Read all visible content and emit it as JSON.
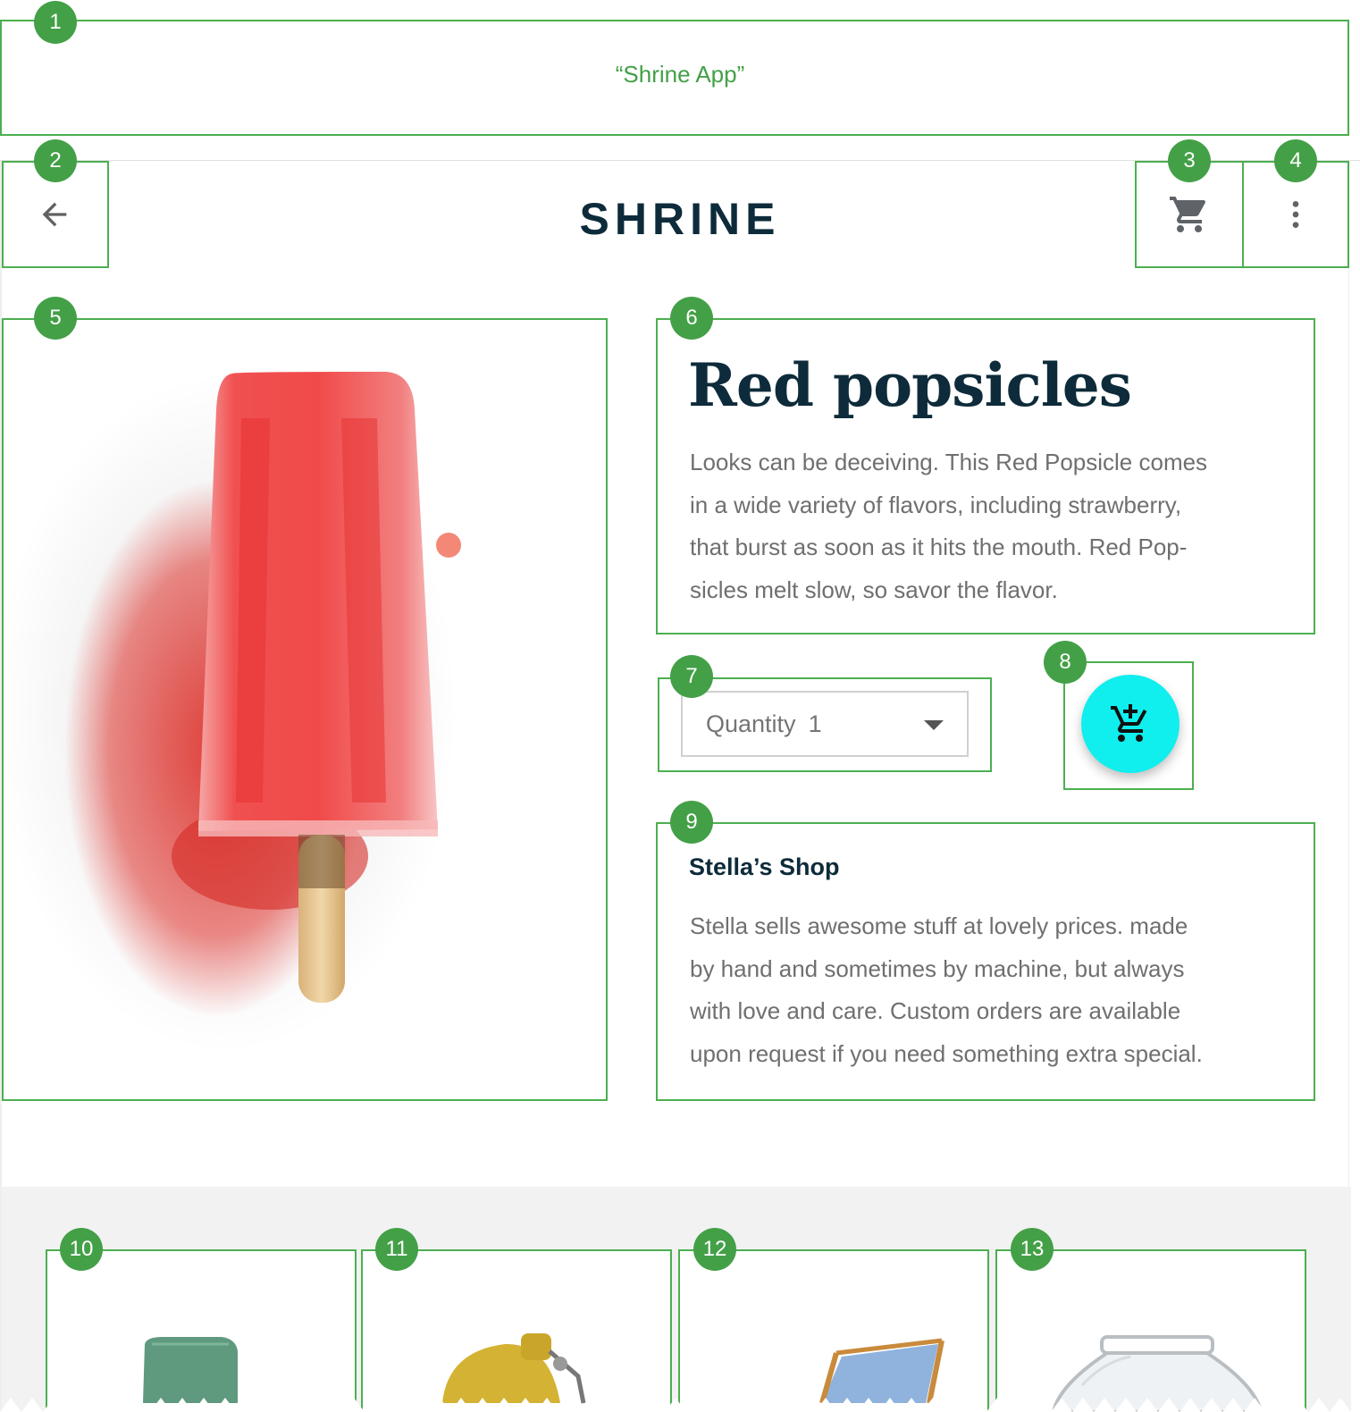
{
  "annotation": {
    "caption": "“Shrine App”",
    "labels": [
      "1",
      "2",
      "3",
      "4",
      "5",
      "6",
      "7",
      "8",
      "9",
      "10",
      "11",
      "12",
      "13"
    ]
  },
  "appbar": {
    "brand": "SHRINE",
    "back_icon": "arrow-back-icon",
    "cart_icon": "shopping-cart-icon",
    "more_icon": "more-vert-icon"
  },
  "product": {
    "title": "Red popsicles",
    "description_lines": [
      "Looks can be deceiving. This Red Popsicle comes",
      "in a wide variety of flavors, including strawberry,",
      "that burst as soon as it hits the mouth. Red Pop-",
      "sicles melt slow, so savor the flavor."
    ],
    "quantity_label": "Quantity",
    "quantity_value": "1",
    "add_to_cart_icon": "add-shopping-cart-icon"
  },
  "shop": {
    "name": "Stella’s Shop",
    "description_lines": [
      "Stella sells awesome stuff at lovely prices. made",
      "by hand and sometimes by machine, but always",
      "with love and care. Custom orders are available",
      "upon request if you need something extra special."
    ]
  },
  "related_items": [
    {
      "image": "green-fabric-item"
    },
    {
      "image": "yellow-kettle-item"
    },
    {
      "image": "blue-deck-chair-item"
    },
    {
      "image": "glass-jar-item"
    }
  ],
  "colors": {
    "annotation_green": "#43a047",
    "brand_dark": "#0d2b3a",
    "fab_cyan": "#10eeee",
    "body_text": "#6f6f6f"
  }
}
